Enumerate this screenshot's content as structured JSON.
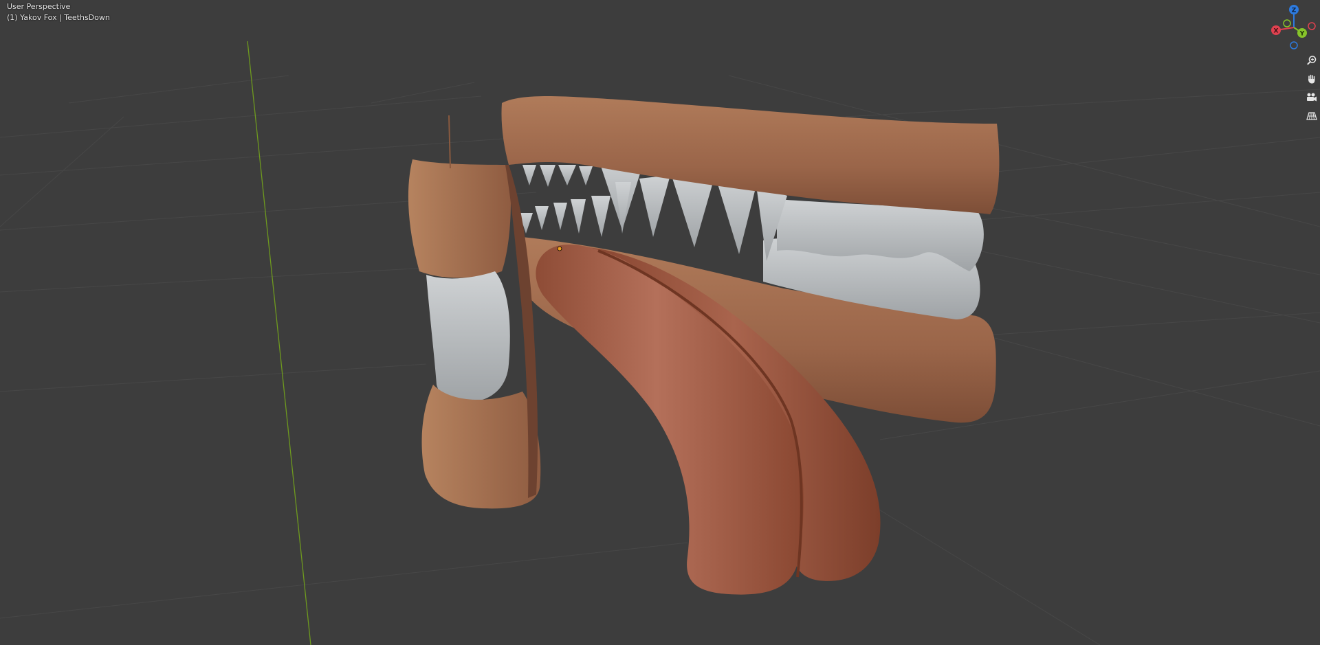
{
  "viewport": {
    "view_mode": "User Perspective",
    "object_info": "(1) Yakov Fox | TeethsDown"
  },
  "gizmo": {
    "z_label": "Z",
    "x_label": "X",
    "y_label": "Y",
    "colors": {
      "z": "#2d7be0",
      "x": "#e0414f",
      "y": "#86c42a"
    }
  },
  "nav_tools": [
    {
      "icon": "zoom-icon"
    },
    {
      "icon": "hand-pan-icon"
    },
    {
      "icon": "camera-view-icon"
    },
    {
      "icon": "perspective-grid-icon"
    }
  ],
  "colors": {
    "background": "#3d3d3d",
    "grid_line": "#4a4a4a",
    "y_axis": "#6e9a1e",
    "gum": "#a06d4f",
    "teeth": "#b8bcbf",
    "tongue": "#a4614a"
  }
}
